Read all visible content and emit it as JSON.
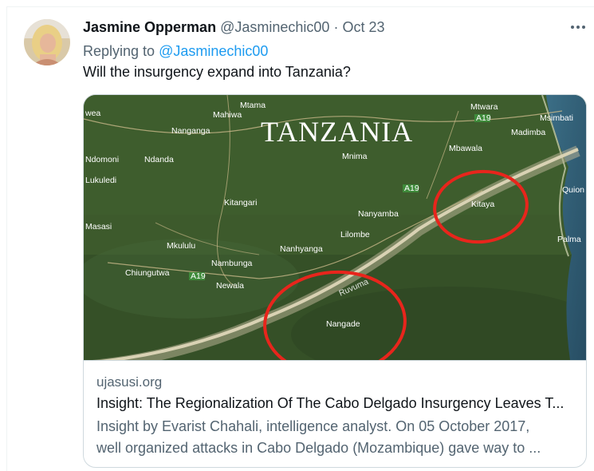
{
  "tweet": {
    "author_name": "Jasmine Opperman",
    "author_handle": "@Jasminechic00",
    "separator": "·",
    "date": "Oct 23",
    "replying_prefix": "Replying to",
    "replying_to": "@Jasminechic00",
    "text": "Will the insurgency expand into Tanzania?",
    "more_icon": "more-horizontal-icon"
  },
  "card": {
    "domain": "ujasusi.org",
    "title": "Insight: The Regionalization Of The Cabo Delgado Insurgency Leaves T...",
    "description_line1": "Insight by Evarist Chahali, intelligence analyst. On 05 October 2017,",
    "description_line2": "well organized attacks in Cabo Delgado (Mozambique) gave way to ...",
    "map": {
      "title": "TANZANIA",
      "labels": {
        "mtama": "Mtama",
        "mtwara": "Mtwara",
        "msimbati": "Msimbati",
        "mahiwa": "Mahiwa",
        "wea": "wea",
        "madimba": "Madimba",
        "nanganga": "Nanganga",
        "mbawala": "Mbawala",
        "ndomoni": "Ndomoni",
        "ndanda": "Ndanda",
        "mnima": "Mnima",
        "lukuledi": "Lukuledi",
        "quion": "Quion",
        "kitangari": "Kitangari",
        "kitaya": "Kitaya",
        "nanyamba": "Nanyamba",
        "masasi": "Masasi",
        "lilombe": "Lilombe",
        "palma": "Palma",
        "mkululu": "Mkululu",
        "nanhyanga": "Nanhyanga",
        "nambunga": "Nambunga",
        "chiungutwa": "Chiungutwa",
        "newala": "Newala",
        "nangade": "Nangade",
        "ruvuma": "Ruvuma",
        "road_a19": "A19"
      },
      "colors": {
        "vegetation": "#3d5a2c",
        "river": "#cfc7a6",
        "circle": "#e8251c"
      }
    }
  }
}
